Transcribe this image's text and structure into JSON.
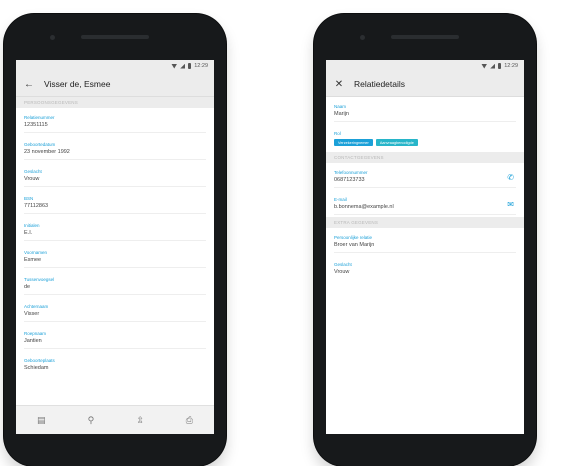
{
  "colors": {
    "accent": "#1ba0d8",
    "chip_primary": "#1ba0d8",
    "chip_secondary": "#27b5c9"
  },
  "status_bar": {
    "time": "12:29"
  },
  "left_screen": {
    "title": "Visser de, Esmee",
    "back_icon": "arrow-left-icon",
    "section_header": "PERSOONSGEGEVENS",
    "fields": [
      {
        "label": "Relatienummer",
        "value": "12351115"
      },
      {
        "label": "Geboortedatum",
        "value": "23 november 1992"
      },
      {
        "label": "Geslacht",
        "value": "Vrouw"
      },
      {
        "label": "BSN",
        "value": "77112863"
      },
      {
        "label": "Initialen",
        "value": "E.I."
      },
      {
        "label": "Voornamen",
        "value": "Esmee"
      },
      {
        "label": "Tussenvoegsel",
        "value": "de"
      },
      {
        "label": "Achternaam",
        "value": "Visser"
      },
      {
        "label": "Roepnaam",
        "value": "Jantien"
      },
      {
        "label": "Geboorteplaats",
        "value": "Schiedam"
      }
    ],
    "bottom_nav": [
      "contact-card-icon",
      "search-icon",
      "upload-icon",
      "print-icon"
    ]
  },
  "right_screen": {
    "title": "Relatiedetails",
    "close_icon": "close-icon",
    "name_field": {
      "label": "Naam",
      "value": "Marijn"
    },
    "roles_label": "Rol",
    "roles": [
      "Verzekeringnemer",
      "Aanvraagbenodigde"
    ],
    "contact_header": "CONTACTGEGEVENS",
    "contact_fields": [
      {
        "label": "Telefoonnummer",
        "value": "0687123733",
        "action_icon": "phone-icon"
      },
      {
        "label": "E-mail",
        "value": "b.bonnema@example.nl",
        "action_icon": "mail-icon"
      }
    ],
    "extra_header": "EXTRA GEGEVENS",
    "extra_fields": [
      {
        "label": "Persoonlijke relatie",
        "value": "Broer van Marijn"
      },
      {
        "label": "Geslacht",
        "value": "Vrouw"
      }
    ]
  }
}
